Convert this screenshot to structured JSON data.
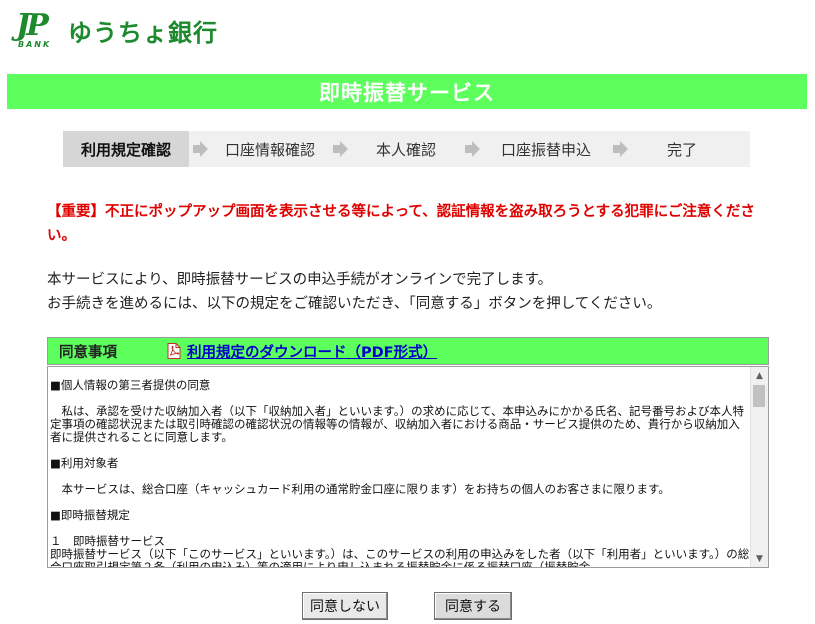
{
  "header": {
    "logo_mark": "JP",
    "logo_sub": "BANK",
    "bank_name": "ゆうちょ銀行"
  },
  "title": "即時振替サービス",
  "steps": [
    {
      "label": "利用規定確認",
      "active": true
    },
    {
      "label": "口座情報確認",
      "active": false
    },
    {
      "label": "本人確認",
      "active": false
    },
    {
      "label": "口座振替申込",
      "active": false
    },
    {
      "label": "完了",
      "active": false
    }
  ],
  "warning": "【重要】不正にポップアップ画面を表示させる等によって、認証情報を盗み取ろうとする犯罪にご注意ください。",
  "intro": {
    "line1": "本サービスにより、即時振替サービスの申込手続がオンラインで完了します。",
    "line2": "お手続きを進めるには、以下の規定をご確認いただき、「同意する」ボタンを押してください。"
  },
  "agreement": {
    "heading": "同意事項",
    "download_link": "利用規定のダウンロード（PDF形式）",
    "terms": [
      "■個人情報の第三者提供の同意",
      "",
      "　私は、承認を受けた収納加入者（以下「収納加入者」といいます。）の求めに応じて、本申込みにかかる氏名、記号番号および本人特定事項の確認状況または取引時確認の確認状況の情報等の情報が、収納加入者における商品・サービス提供のため、貴行から収納加入者に提供されることに同意します。",
      "",
      "■利用対象者",
      "",
      "　本サービスは、総合口座（キャッシュカード利用の通常貯金口座に限ります）をお持ちの個人のお客さまに限ります。",
      "",
      "■即時振替規定",
      "",
      "１　即時振替サービス",
      "即時振替サービス（以下「このサービス」といいます。）は、このサービスの利用の申込みをした者（以下「利用者」といいます。）の総合口座取引規定第２条（利用の申込み）等の適用により申し込まれる振替貯金に係る振替口座（振替貯金"
    ]
  },
  "buttons": {
    "decline": "同意しない",
    "agree": "同意する"
  },
  "colors": {
    "brand_green": "#1e8a2e",
    "bar_green": "#5cff5c",
    "warning_red": "#e00000",
    "link_blue": "#0000cc"
  }
}
